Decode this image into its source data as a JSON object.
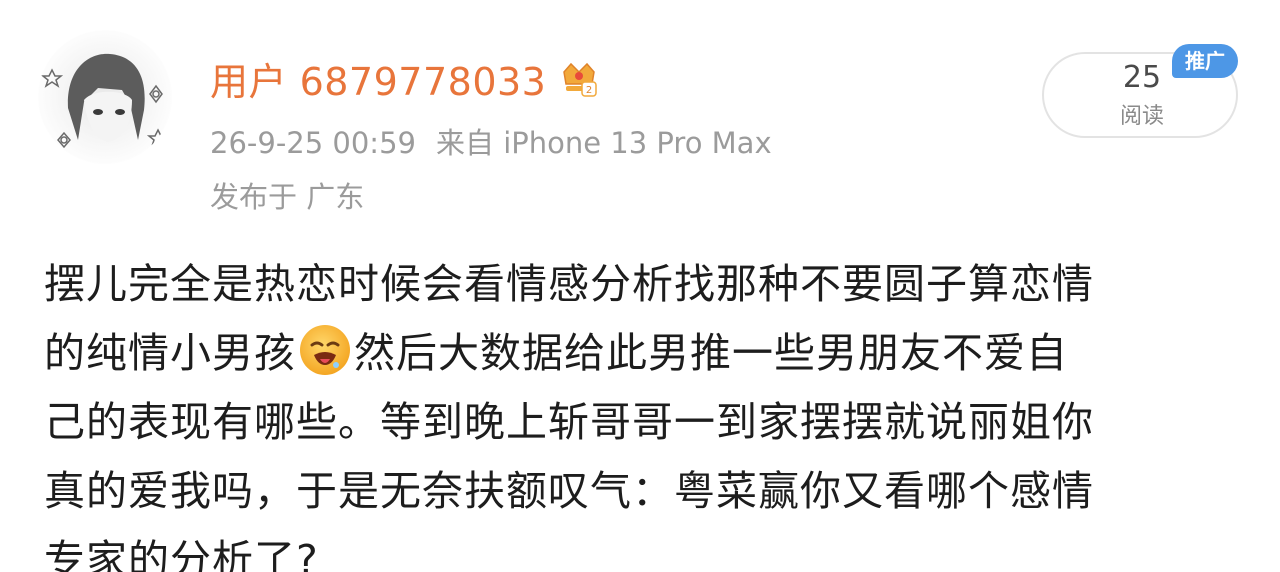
{
  "post": {
    "author": "用户 6879778033",
    "timestamp": "26-9-25 00:59",
    "source": "来自 iPhone 13 Pro Max",
    "location": "发布于 广东",
    "read_count": "25",
    "read_label": "阅读",
    "promo_tag": "推广",
    "badge_icon": "crown-badge-icon",
    "body_lines": {
      "l1": "摆儿完全是热恋时候会看情感分析找那种不要圆子算恋情",
      "l2a": "的纯情小男孩",
      "l2b": "然后大数据给此男推一些男朋友不爱自",
      "l3": "己的表现有哪些。等到晚上斩哥哥一到家摆摆就说丽姐你",
      "l4": "真的爱我吗，于是无奈扶额叹气：粤菜赢你又看哪个感情",
      "l5": "专家的分析了?"
    },
    "emoji_icon": "drooling-face-emoji-icon"
  },
  "colors": {
    "author": "#e8753b",
    "meta": "#9b9b9b",
    "body": "#1d1d1d",
    "promo": "#4d97e6"
  }
}
